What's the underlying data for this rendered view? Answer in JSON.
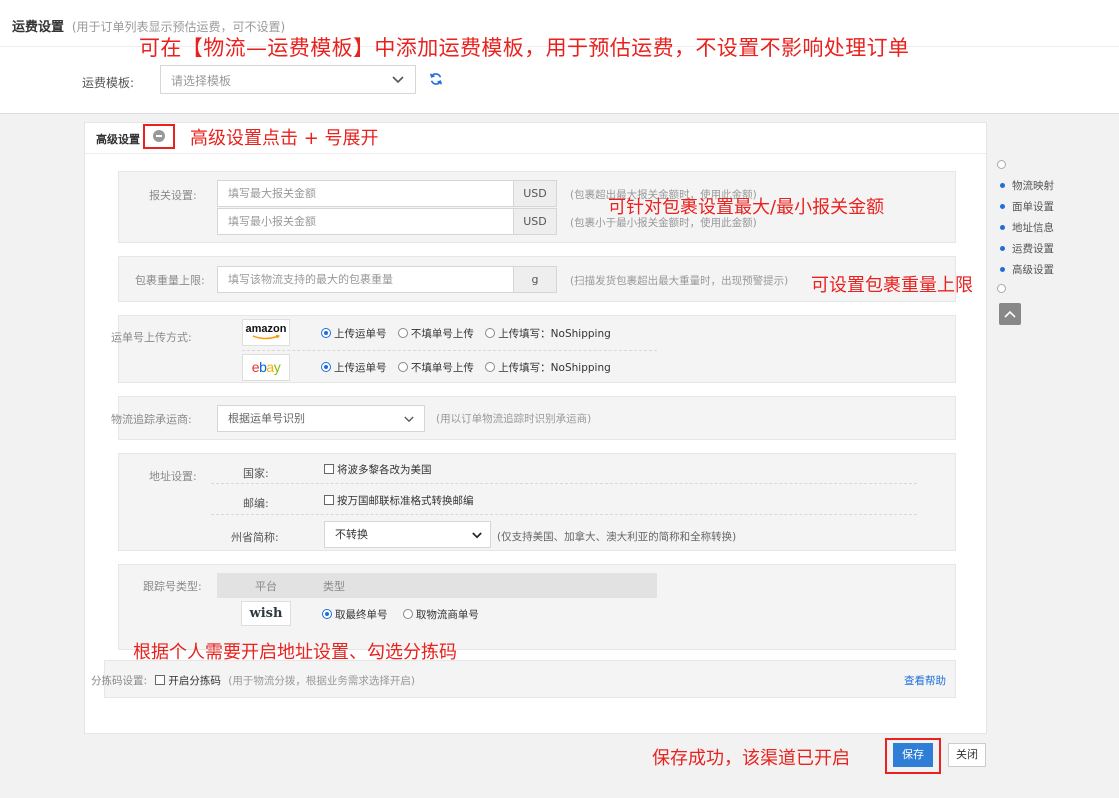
{
  "freight": {
    "section_title": "运费设置",
    "section_hint": "(用于订单列表显示预估运费，可不设置)",
    "template_label": "运费模板:",
    "template_placeholder": "请选择模板"
  },
  "advanced": {
    "title": "高级设置",
    "customs": {
      "label": "报关设置:",
      "max_placeholder": "填写最大报关金额",
      "min_placeholder": "填写最小报关金额",
      "currency": "USD",
      "max_hint": "(包裹超出最大报关金额时，使用此金额)",
      "min_hint": "(包裹小于最小报关金额时，使用此金额)"
    },
    "weight": {
      "label": "包裹重量上限:",
      "placeholder": "填写该物流支持的最大的包裹重量",
      "unit": "g",
      "hint": "(扫描发货包裹超出最大重量时，出现预警提示)"
    },
    "upload": {
      "label": "运单号上传方式:",
      "rows": [
        {
          "platform": "amazon",
          "options": [
            "上传运单号",
            "不填单号上传",
            "上传填写：NoShipping"
          ],
          "selected": 0
        },
        {
          "platform": "ebay",
          "options": [
            "上传运单号",
            "不填单号上传",
            "上传填写：NoShipping"
          ],
          "selected": 0
        }
      ]
    },
    "carrier": {
      "label": "物流追踪承运商:",
      "value": "根据运单号识别",
      "hint": "(用以订单物流追踪时识别承运商)"
    },
    "address": {
      "label": "地址设置:",
      "country_label": "国家:",
      "country_option": "将波多黎各改为美国",
      "zip_label": "邮编:",
      "zip_option": "按万国邮联标准格式转换邮编",
      "state_label": "州省简称:",
      "state_value": "不转换",
      "state_hint": "(仅支持美国、加拿大、澳大利亚的简称和全称转换)"
    },
    "tracking": {
      "label": "跟踪号类型:",
      "col_platform": "平台",
      "col_type": "类型",
      "platform": "wish",
      "options": [
        "取最终单号",
        "取物流商单号"
      ],
      "selected": 0
    },
    "sorting": {
      "label": "分拣码设置:",
      "option": "开启分拣码",
      "hint": "(用于物流分拨，根据业务需求选择开启)",
      "help_link": "查看帮助"
    }
  },
  "side_nav": [
    "物流映射",
    "面单设置",
    "地址信息",
    "运费设置",
    "高级设置"
  ],
  "buttons": {
    "save": "保存",
    "close": "关闭"
  },
  "annotations": {
    "freight_template": "可在【物流—运费模板】中添加运费模板，用于预估运费，不设置不影响处理订单",
    "expand": "高级设置点击 + 号展开",
    "customs": "可针对包裹设置最大/最小报关金额",
    "weight": "可设置包裹重量上限",
    "address": "根据个人需要开启地址设置、勾选分拣码",
    "save": "保存成功，该渠道已开启"
  },
  "colors": {
    "primary": "#1e6fd9",
    "annotation": "#e8231f",
    "amazon": "#111111",
    "ebay_e": "#e53238",
    "ebay_b": "#0064d2",
    "ebay_a": "#f5af02",
    "ebay_y": "#86b817"
  }
}
